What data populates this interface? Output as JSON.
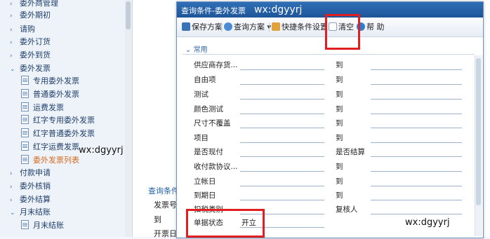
{
  "sidebar": {
    "items": [
      {
        "label": "委外商管理",
        "arrow": "›",
        "icon": "chevron-right-icon"
      },
      {
        "label": "委外期初",
        "arrow": "›",
        "icon": "chevron-right-icon"
      },
      {
        "label": "请购",
        "arrow": "›",
        "icon": "chevron-right-icon"
      },
      {
        "label": "委外订货",
        "arrow": "›",
        "icon": "chevron-right-icon"
      },
      {
        "label": "委外到货",
        "arrow": "›",
        "icon": "chevron-right-icon"
      },
      {
        "label": "委外发票",
        "arrow": "⌄",
        "icon": "chevron-down-icon"
      },
      {
        "label": "专用委外发票"
      },
      {
        "label": "普通委外发票"
      },
      {
        "label": "运费发票"
      },
      {
        "label": "红字专用委外发票"
      },
      {
        "label": "红字普通委外发票"
      },
      {
        "label": "红字运费发票"
      },
      {
        "label": "委外发票列表"
      },
      {
        "label": "付款申请",
        "arrow": "›",
        "icon": "chevron-right-icon"
      },
      {
        "label": "委外核销",
        "arrow": "›",
        "icon": "chevron-right-icon"
      },
      {
        "label": "委外结算",
        "arrow": "›",
        "icon": "chevron-right-icon"
      },
      {
        "label": "月末结账",
        "arrow": "⌄",
        "icon": "chevron-down-icon"
      },
      {
        "label": "月末结账"
      }
    ]
  },
  "background": {
    "query_link": "查询条件",
    "invoice_no": "发票号",
    "to": "到",
    "invoice_date": "开票日"
  },
  "dialog": {
    "title": "查询条件-委外发票",
    "watermark_title": "wx:dgyyrj",
    "toolbar": {
      "save": "保存方案",
      "query": "查询方案",
      "query_arrow": "▾",
      "shortcut": "快捷条件设置",
      "clear": "清空",
      "help": "帮 助"
    },
    "section": "常用",
    "section_arrow": "⌄",
    "rows": [
      {
        "label": "供应商存货...",
        "to": "到"
      },
      {
        "label": "自由项",
        "to": "到"
      },
      {
        "label": "测试",
        "to": "到"
      },
      {
        "label": "颜色测试",
        "to": "到"
      },
      {
        "label": "尺寸不覆盖",
        "to": "到"
      },
      {
        "label": "项目",
        "to": "到"
      },
      {
        "label": "是否现付",
        "to": "是否结算"
      },
      {
        "label": "收付款协议...",
        "to": "到"
      },
      {
        "label": "立帐日",
        "to": "到"
      },
      {
        "label": "到期日",
        "to": "到"
      },
      {
        "label": "扣税类别",
        "to": "复核人"
      },
      {
        "label": "单据状态",
        "value": "开立",
        "to": ""
      }
    ]
  },
  "watermarks": {
    "sidebar": "wx:dgyyrj",
    "dialog": "wx:dgyyrj"
  }
}
